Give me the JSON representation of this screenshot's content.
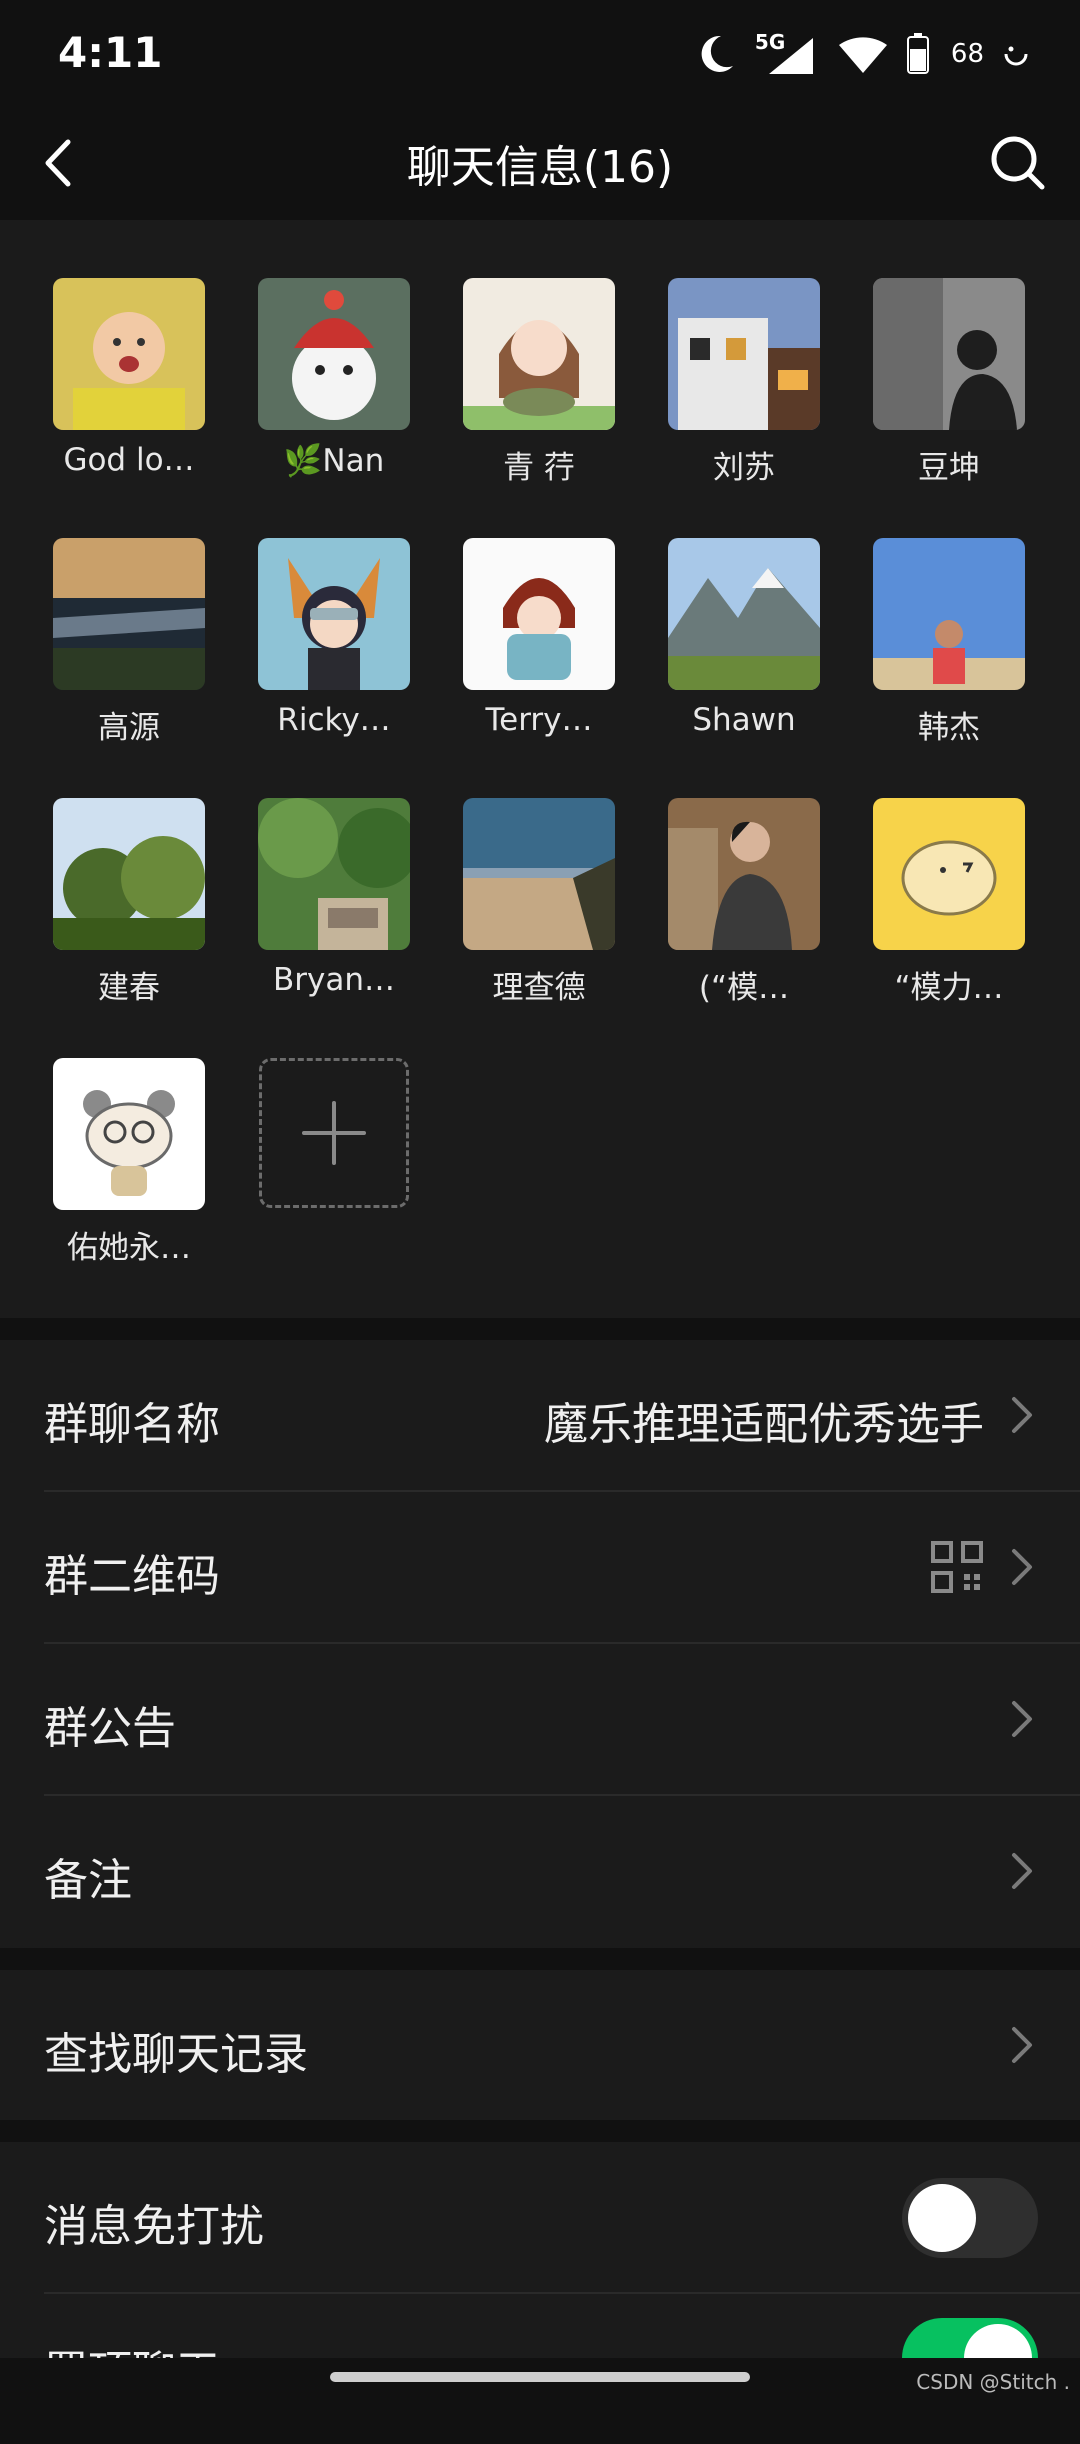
{
  "status_bar": {
    "time": "4:11",
    "network": "5G",
    "battery": "68",
    "icons": [
      "moon-icon",
      "signal-icon",
      "wifi-icon",
      "battery-icon",
      "face-icon"
    ]
  },
  "nav": {
    "title": "聊天信息(16)",
    "back_icon": "chevron-left-icon",
    "search_icon": "search-icon"
  },
  "members": [
    {
      "name": "God lo…",
      "color": "#d8c25a"
    },
    {
      "name": "🌿Nan",
      "color": "#b5423c"
    },
    {
      "name": "青 荇",
      "color": "#ede3d6"
    },
    {
      "name": "刘苏",
      "color": "#6b7aa0"
    },
    {
      "name": "豆坤",
      "color": "#4a4a4a"
    },
    {
      "name": "高源",
      "color": "#3a4a5a"
    },
    {
      "name": "Ricky…",
      "color": "#7fb6cc"
    },
    {
      "name": "Terry…",
      "color": "#f2f2f2"
    },
    {
      "name": "Shawn",
      "color": "#8aa6c4"
    },
    {
      "name": "韩杰",
      "color": "#6fa0d8"
    },
    {
      "name": "建春",
      "color": "#5d7e4c"
    },
    {
      "name": "Bryan…",
      "color": "#4f7c3b"
    },
    {
      "name": "理查德",
      "color": "#b59c78"
    },
    {
      "name": "(“模…",
      "color": "#8a6a4a"
    },
    {
      "name": "“模力…",
      "color": "#f7d34a"
    },
    {
      "name": "佑她永…",
      "color": "#ffffff"
    }
  ],
  "add_member_icon": "plus-icon",
  "settings": {
    "group_name": {
      "label": "群聊名称",
      "value": "魔乐推理适配优秀选手"
    },
    "group_qr": {
      "label": "群二维码",
      "icon": "qr-code-icon"
    },
    "announcement": {
      "label": "群公告"
    },
    "remark": {
      "label": "备注"
    },
    "search_history": {
      "label": "查找聊天记录"
    },
    "mute": {
      "label": "消息免打扰",
      "enabled": false
    },
    "pin_chat": {
      "label": "置顶聊天",
      "enabled": true
    }
  },
  "colors": {
    "toggle_on": "#07c160",
    "background": "#111111",
    "section": "#1b1b1b"
  },
  "watermark": "CSDN @Stitch ."
}
